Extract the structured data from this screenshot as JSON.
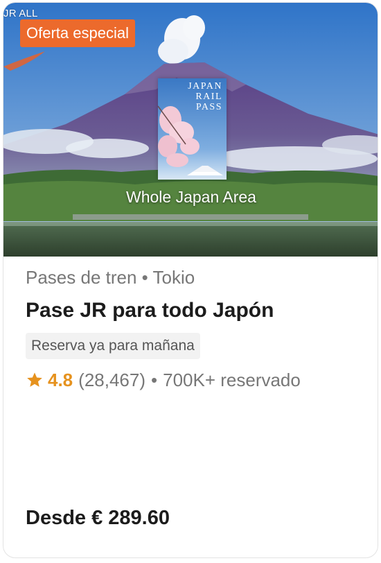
{
  "product_card": {
    "corner_text": "JR ALL",
    "badge": "Oferta especial",
    "pass_card_title": "JAPAN\nRAIL\nPASS",
    "image_caption": "Whole Japan Area",
    "category_text": "Pases de tren • Tokio",
    "title": "Pase JR para todo Japón",
    "availability_tag": "Reserva ya para mañana",
    "rating": "4.8",
    "review_count": "(28,467)",
    "separator": "•",
    "booked_text": "700K+ reservado",
    "price": "Desde € 289.60"
  },
  "colors": {
    "badge_bg": "#ec6a2c",
    "rating_star": "#e6921e",
    "title_text": "#1c1c1c",
    "muted_text": "#777777",
    "tag_bg": "#f2f2f2"
  },
  "icons": {
    "star": "star-icon"
  }
}
